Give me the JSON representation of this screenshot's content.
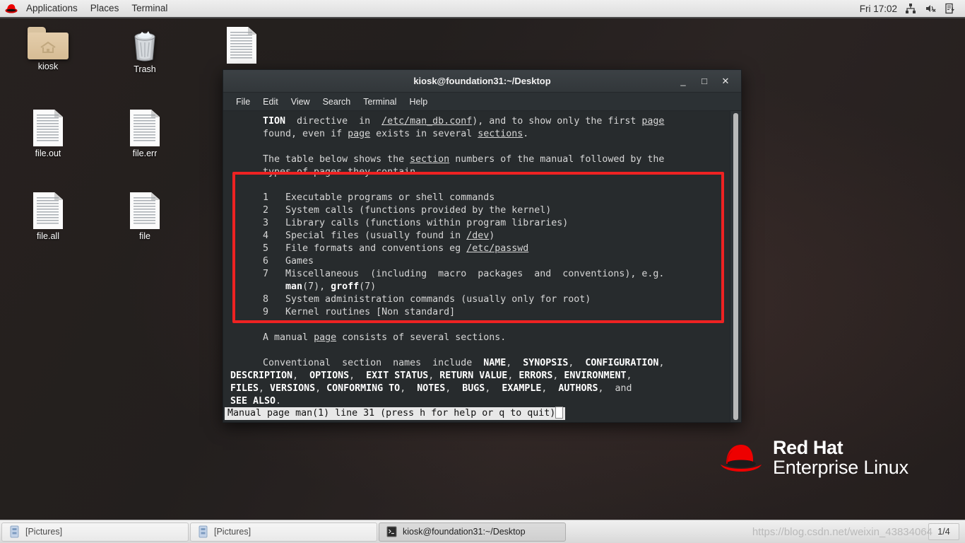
{
  "top_panel": {
    "logo_icon": "redhat-logo-icon",
    "menus": [
      "Applications",
      "Places",
      "Terminal"
    ],
    "clock": "Fri 17:02",
    "tray": [
      "network-icon",
      "volume-muted-icon",
      "power-manager-icon"
    ]
  },
  "desktop": {
    "icons": [
      {
        "label": "kiosk",
        "type": "folder-home-icon"
      },
      {
        "label": "Trash",
        "type": "trash-icon"
      },
      {
        "label": "file.out",
        "type": "document-icon"
      },
      {
        "label": "file.err",
        "type": "document-icon"
      },
      {
        "label": "file.all",
        "type": "document-icon"
      },
      {
        "label": "file",
        "type": "document-icon"
      },
      {
        "label": "",
        "type": "document-icon"
      }
    ],
    "brand": {
      "line1": "Red Hat",
      "line2": "Enterprise Linux",
      "logo_color": "#ee0000"
    }
  },
  "terminal": {
    "title": "kiosk@foundation31:~/Desktop",
    "window_buttons": {
      "minimize": "_",
      "maximize": "□",
      "close": "✕"
    },
    "menus": [
      "File",
      "Edit",
      "View",
      "Search",
      "Terminal",
      "Help"
    ],
    "lines": [
      {
        "indent": "normal",
        "segments": [
          {
            "t": "TION",
            "s": "bold"
          },
          {
            "t": "  directive  in  ",
            "s": ""
          },
          {
            "t": "/etc/man_db.conf",
            "s": "underline"
          },
          {
            "t": "), and to show only the first ",
            "s": ""
          },
          {
            "t": "page",
            "s": "underline"
          }
        ]
      },
      {
        "indent": "normal",
        "segments": [
          {
            "t": "found, even if ",
            "s": ""
          },
          {
            "t": "page",
            "s": "underline"
          },
          {
            "t": " exists in several ",
            "s": ""
          },
          {
            "t": "sections",
            "s": "underline"
          },
          {
            "t": ".",
            "s": ""
          }
        ]
      },
      {
        "indent": "normal",
        "segments": [
          {
            "t": "",
            "s": ""
          }
        ]
      },
      {
        "indent": "normal",
        "segments": [
          {
            "t": "The table below shows the ",
            "s": ""
          },
          {
            "t": "section",
            "s": "underline"
          },
          {
            "t": " numbers of the manual followed by the",
            "s": ""
          }
        ]
      },
      {
        "indent": "normal",
        "segments": [
          {
            "t": "types of pages they contain.",
            "s": ""
          }
        ]
      },
      {
        "indent": "normal",
        "segments": [
          {
            "t": "",
            "s": ""
          }
        ]
      },
      {
        "indent": "normal",
        "segments": [
          {
            "t": "1   Executable programs or shell commands",
            "s": ""
          }
        ]
      },
      {
        "indent": "normal",
        "segments": [
          {
            "t": "2   System calls (functions provided by the kernel)",
            "s": ""
          }
        ]
      },
      {
        "indent": "normal",
        "segments": [
          {
            "t": "3   Library calls (functions within program libraries)",
            "s": ""
          }
        ]
      },
      {
        "indent": "normal",
        "segments": [
          {
            "t": "4   Special files (usually found in ",
            "s": ""
          },
          {
            "t": "/dev",
            "s": "underline"
          },
          {
            "t": ")",
            "s": ""
          }
        ]
      },
      {
        "indent": "normal",
        "segments": [
          {
            "t": "5   File formats and conventions eg ",
            "s": ""
          },
          {
            "t": "/etc/passwd",
            "s": "underline"
          }
        ]
      },
      {
        "indent": "normal",
        "segments": [
          {
            "t": "6   Games",
            "s": ""
          }
        ]
      },
      {
        "indent": "normal",
        "segments": [
          {
            "t": "7   Miscellaneous  (including  macro  packages  and  conventions), e.g.",
            "s": ""
          }
        ]
      },
      {
        "indent": "normal",
        "segments": [
          {
            "t": "    ",
            "s": ""
          },
          {
            "t": "man",
            "s": "bold"
          },
          {
            "t": "(7), ",
            "s": ""
          },
          {
            "t": "groff",
            "s": "bold"
          },
          {
            "t": "(7)",
            "s": ""
          }
        ]
      },
      {
        "indent": "normal",
        "segments": [
          {
            "t": "8   System administration commands (usually only for root)",
            "s": ""
          }
        ]
      },
      {
        "indent": "normal",
        "segments": [
          {
            "t": "9   Kernel routines [Non standard]",
            "s": ""
          }
        ]
      },
      {
        "indent": "normal",
        "segments": [
          {
            "t": "",
            "s": ""
          }
        ]
      },
      {
        "indent": "normal",
        "segments": [
          {
            "t": "A manual ",
            "s": ""
          },
          {
            "t": "page",
            "s": "underline"
          },
          {
            "t": " consists of several sections.",
            "s": ""
          }
        ]
      },
      {
        "indent": "normal",
        "segments": [
          {
            "t": "",
            "s": ""
          }
        ]
      },
      {
        "indent": "normal",
        "segments": [
          {
            "t": "Conventional  section  names  include  ",
            "s": ""
          },
          {
            "t": "NAME",
            "s": "bold"
          },
          {
            "t": ",  ",
            "s": ""
          },
          {
            "t": "SYNOPSIS",
            "s": "bold"
          },
          {
            "t": ",  ",
            "s": ""
          },
          {
            "t": "CONFIGURATION",
            "s": "bold"
          },
          {
            "t": ",",
            "s": ""
          }
        ]
      },
      {
        "indent": "flush",
        "segments": [
          {
            "t": "DESCRIPTION",
            "s": "bold"
          },
          {
            "t": ",  ",
            "s": ""
          },
          {
            "t": "OPTIONS",
            "s": "bold"
          },
          {
            "t": ",  ",
            "s": ""
          },
          {
            "t": "EXIT STATUS",
            "s": "bold"
          },
          {
            "t": ", ",
            "s": ""
          },
          {
            "t": "RETURN VALUE",
            "s": "bold"
          },
          {
            "t": ", ",
            "s": ""
          },
          {
            "t": "ERRORS",
            "s": "bold"
          },
          {
            "t": ", ",
            "s": ""
          },
          {
            "t": "ENVIRONMENT",
            "s": "bold"
          },
          {
            "t": ",",
            "s": ""
          }
        ]
      },
      {
        "indent": "flush",
        "segments": [
          {
            "t": "FILES",
            "s": "bold"
          },
          {
            "t": ", ",
            "s": ""
          },
          {
            "t": "VERSIONS",
            "s": "bold"
          },
          {
            "t": ", ",
            "s": ""
          },
          {
            "t": "CONFORMING TO",
            "s": "bold"
          },
          {
            "t": ",  ",
            "s": ""
          },
          {
            "t": "NOTES",
            "s": "bold"
          },
          {
            "t": ",  ",
            "s": ""
          },
          {
            "t": "BUGS",
            "s": "bold"
          },
          {
            "t": ",  ",
            "s": ""
          },
          {
            "t": "EXAMPLE",
            "s": "bold"
          },
          {
            "t": ",  ",
            "s": ""
          },
          {
            "t": "AUTHORS",
            "s": "bold"
          },
          {
            "t": ",  and",
            "s": ""
          }
        ]
      },
      {
        "indent": "flush",
        "segments": [
          {
            "t": "SEE ALSO",
            "s": "bold"
          },
          {
            "t": ".",
            "s": ""
          }
        ]
      }
    ],
    "status_line": "Manual page man(1) line 31 (press h for help or q to quit)",
    "cursor": "block-cursor"
  },
  "annotation": {
    "type": "red-rectangle-highlight",
    "color": "#ee2222"
  },
  "taskbar": {
    "buttons": [
      {
        "label": "[Pictures]",
        "icon": "window-icon",
        "active": false
      },
      {
        "label": "[Pictures]",
        "icon": "window-icon",
        "active": false
      },
      {
        "label": "kiosk@foundation31:~/Desktop",
        "icon": "terminal-icon",
        "active": true
      }
    ],
    "workspace": "1/4"
  },
  "watermark": "https://blog.csdn.net/weixin_43834064"
}
